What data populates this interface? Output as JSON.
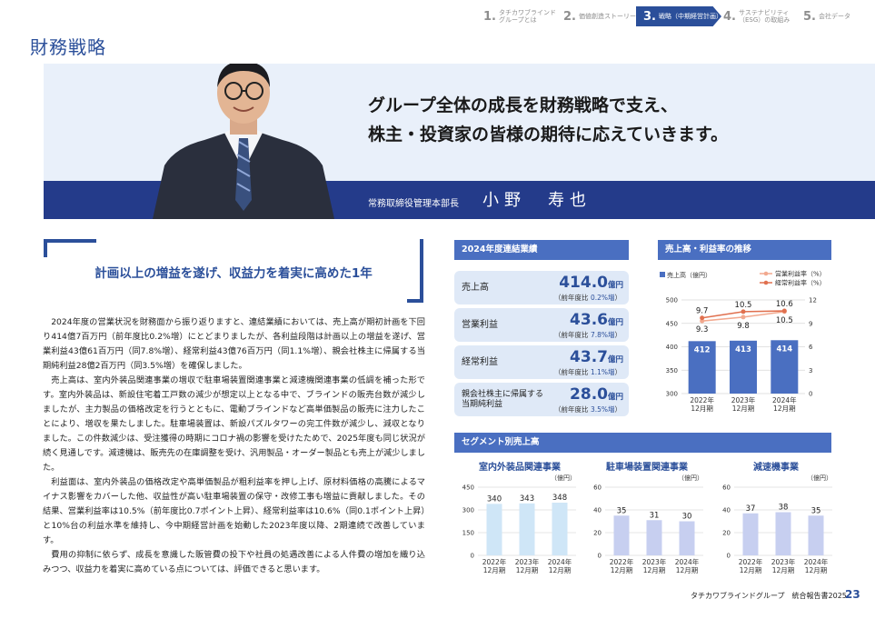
{
  "nav": {
    "steps": [
      {
        "num": "1.",
        "label": "タチカワブラインド\nグループとは"
      },
      {
        "num": "2.",
        "label": "価値創造ストーリー"
      },
      {
        "num": "3.",
        "label": "戦略（中期経営計画）"
      },
      {
        "num": "4.",
        "label": "サステナビリティ\n（ESG）の取組み"
      },
      {
        "num": "5.",
        "label": "会社データ"
      }
    ]
  },
  "page_title": "財務戦略",
  "hero": {
    "quote": "グループ全体の成長を財務戦略で支え、\n株主・投資家の皆様の期待に応えていきます。",
    "role": "常務取締役管理本部長",
    "name": "小野　寿也"
  },
  "sub_heading": "計画以上の増益を遂げ、収益力を着実に高めた1年",
  "body": [
    "2024年度の営業状況を財務面から振り返りますと、連結業績においては、売上高が期初計画を下回り414億7百万円（前年度比0.2%増）にとどまりましたが、各利益段階は計画以上の増益を遂げ、営業利益43億61百万円（同7.8%増）、経常利益43億76百万円（同1.1%増）、親会社株主に帰属する当期純利益28億2百万円（同3.5%増）を確保しました。",
    "売上高は、室内外装品関連事業の増収で駐車場装置関連事業と減速機関連事業の低調を補った形です。室内外装品は、新設住宅着工戸数の減少が想定以上となる中で、ブラインドの販売台数が減少しましたが、主力製品の価格改定を行うとともに、電動ブラインドなど高単価製品の販売に注力したことにより、増収を果たしました。駐車場装置は、新設パズルタワーの完工件数が減少し、減収となりました。この件数減少は、受注獲得の時期にコロナ禍の影響を受けたためで、2025年度も同じ状況が続く見通しです。減速機は、販売先の在庫調整を受け、汎用製品・オーダー製品とも売上が減少しました。",
    "利益面は、室内外装品の価格改定や高単価製品が粗利益率を押し上げ、原材料価格の高騰によるマイナス影響をカバーした他、収益性が高い駐車場装置の保守・改修工事も増益に貢献しました。その結果、営業利益率は10.5%（前年度比0.7ポイント上昇）、経常利益率は10.6%（同0.1ポイント上昇）と10%台の利益水準を維持し、今中期経営計画を始動した2023年度以降、2期連続で改善しています。",
    "費用の抑制に依らず、成長を意識した販管費の投下や社員の処遇改善による人件費の増加を織り込みつつ、収益力を着実に高めている点については、評価できると思います。"
  ],
  "kpi_panel": {
    "title": "2024年度連結業績",
    "items": [
      {
        "label": "売上高",
        "value": "414.0",
        "unit": "億円",
        "change_prefix": "（前年度比 ",
        "change": "0.2%増",
        "change_suffix": "）"
      },
      {
        "label": "営業利益",
        "value": "43.6",
        "unit": "億円",
        "change_prefix": "（前年度比 ",
        "change": "7.8%増",
        "change_suffix": "）"
      },
      {
        "label": "経常利益",
        "value": "43.7",
        "unit": "億円",
        "change_prefix": "（前年度比 ",
        "change": "1.1%増",
        "change_suffix": "）"
      },
      {
        "label": "親会社株主に帰属する\n当期純利益",
        "value": "28.0",
        "unit": "億円",
        "change_prefix": "（前年度比 ",
        "change": "3.5%増",
        "change_suffix": "）"
      }
    ]
  },
  "trend_panel": {
    "title": "売上高・利益率の推移"
  },
  "segment_panel": {
    "title": "セグメント別売上高"
  },
  "footer": {
    "report": "タチカワブラインドグループ　統合報告書2025",
    "page": "23"
  },
  "colors": {
    "brand": "#2b4f9a",
    "panel_head": "#4a6fc1",
    "bar": "#4a6fc1",
    "op_line": "#f2a98f",
    "ord_line": "#e0704f"
  },
  "chart_data": [
    {
      "type": "bar",
      "title": "",
      "categories": [
        "2022年\n12月期",
        "2023年\n12月期",
        "2024年\n12月期"
      ],
      "series": [
        {
          "name": "売上高（億円）",
          "type": "bar",
          "axis": "left",
          "values": [
            412,
            413,
            414
          ]
        },
        {
          "name": "営業利益率（%）",
          "type": "line",
          "axis": "right",
          "values": [
            9.3,
            9.8,
            10.5
          ]
        },
        {
          "name": "経常利益率（%）",
          "type": "line",
          "axis": "right",
          "values": [
            9.7,
            10.5,
            10.6
          ]
        }
      ],
      "y_left": {
        "ticks": [
          300,
          350,
          400,
          450,
          500
        ],
        "ylim": [
          300,
          500
        ]
      },
      "y_right": {
        "ticks": [
          0,
          3,
          6,
          9,
          12
        ],
        "ylim": [
          0,
          12
        ]
      },
      "legend": "top"
    },
    {
      "type": "bar",
      "title": "室内外装品関連事業",
      "unit": "（億円）",
      "categories": [
        "2022年\n12月期",
        "2023年\n12月期",
        "2024年\n12月期"
      ],
      "values": [
        340,
        343,
        348
      ],
      "yticks": [
        0,
        150,
        300,
        450
      ],
      "ylim": [
        0,
        450
      ]
    },
    {
      "type": "bar",
      "title": "駐車場装置関連事業",
      "unit": "（億円）",
      "categories": [
        "2022年\n12月期",
        "2023年\n12月期",
        "2024年\n12月期"
      ],
      "values": [
        35,
        31,
        30
      ],
      "yticks": [
        0,
        20,
        40,
        60
      ],
      "ylim": [
        0,
        60
      ]
    },
    {
      "type": "bar",
      "title": "減速機事業",
      "unit": "（億円）",
      "categories": [
        "2022年\n12月期",
        "2023年\n12月期",
        "2024年\n12月期"
      ],
      "values": [
        37,
        38,
        35
      ],
      "yticks": [
        0,
        20,
        40,
        60
      ],
      "ylim": [
        0,
        60
      ]
    }
  ]
}
